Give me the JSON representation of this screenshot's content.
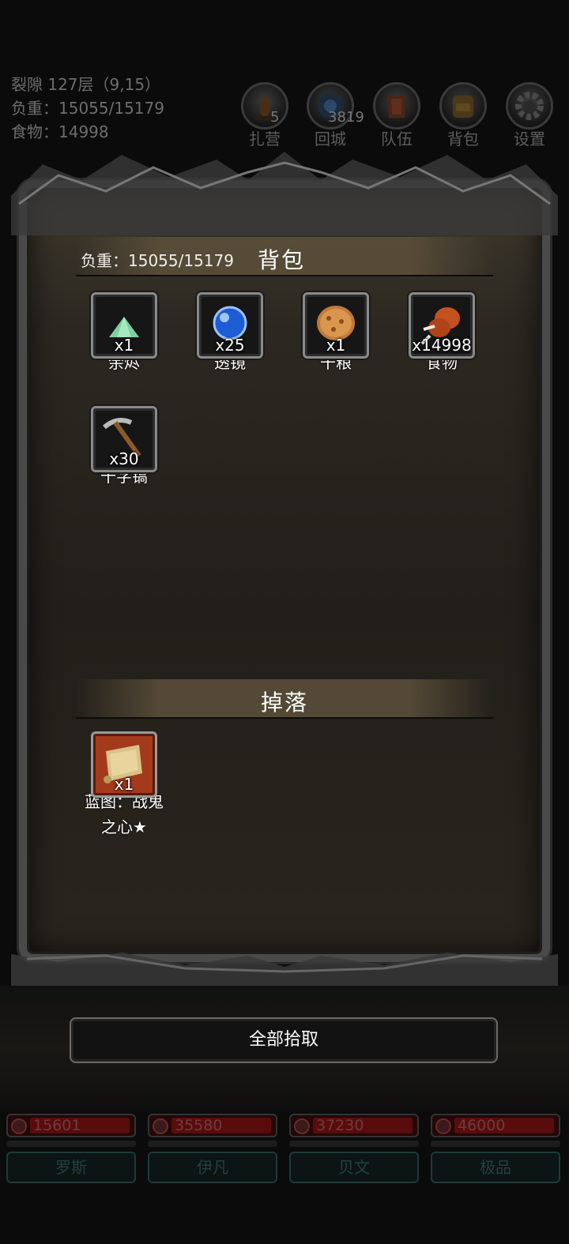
{
  "hud": {
    "location": "裂隙 127层（9,15）",
    "load": "负重：15055/15179",
    "food": "食物：14998",
    "buttons": [
      {
        "label": "扎营",
        "badge": "5",
        "icon": "campfire-icon"
      },
      {
        "label": "回城",
        "badge": "3819",
        "icon": "portal-icon"
      },
      {
        "label": "队伍",
        "badge": "",
        "icon": "team-icon"
      },
      {
        "label": "背包",
        "badge": "",
        "icon": "backpack-icon"
      },
      {
        "label": "设置",
        "badge": "",
        "icon": "gear-icon"
      }
    ]
  },
  "bag": {
    "load": "负重：15055/15179",
    "title": "背包",
    "items": [
      {
        "name": "余烬",
        "qty": "x1",
        "icon": "ember-icon"
      },
      {
        "name": "透镜",
        "qty": "x25",
        "icon": "lens-icon"
      },
      {
        "name": "干粮",
        "qty": "x1",
        "icon": "ration-icon"
      },
      {
        "name": "食物",
        "qty": "x14998",
        "icon": "meat-icon"
      },
      {
        "name": "十字镐",
        "qty": "x30",
        "icon": "pickaxe-icon"
      }
    ]
  },
  "drop": {
    "title": "掉落",
    "items": [
      {
        "name_line1": "蓝图：战鬼",
        "name_line2": "之心★",
        "qty": "x1",
        "icon": "blueprint-scroll-icon"
      }
    ]
  },
  "pickup_all": "全部拾取",
  "heroes": [
    {
      "name": "罗斯",
      "hp": "15601"
    },
    {
      "name": "伊凡",
      "hp": "35580"
    },
    {
      "name": "贝文",
      "hp": "37230"
    },
    {
      "name": "极品",
      "hp": "46000"
    }
  ],
  "colors": {
    "panel": "#221f1a",
    "title_band": "#5c503a",
    "drop_slot": "#a33a1c"
  }
}
